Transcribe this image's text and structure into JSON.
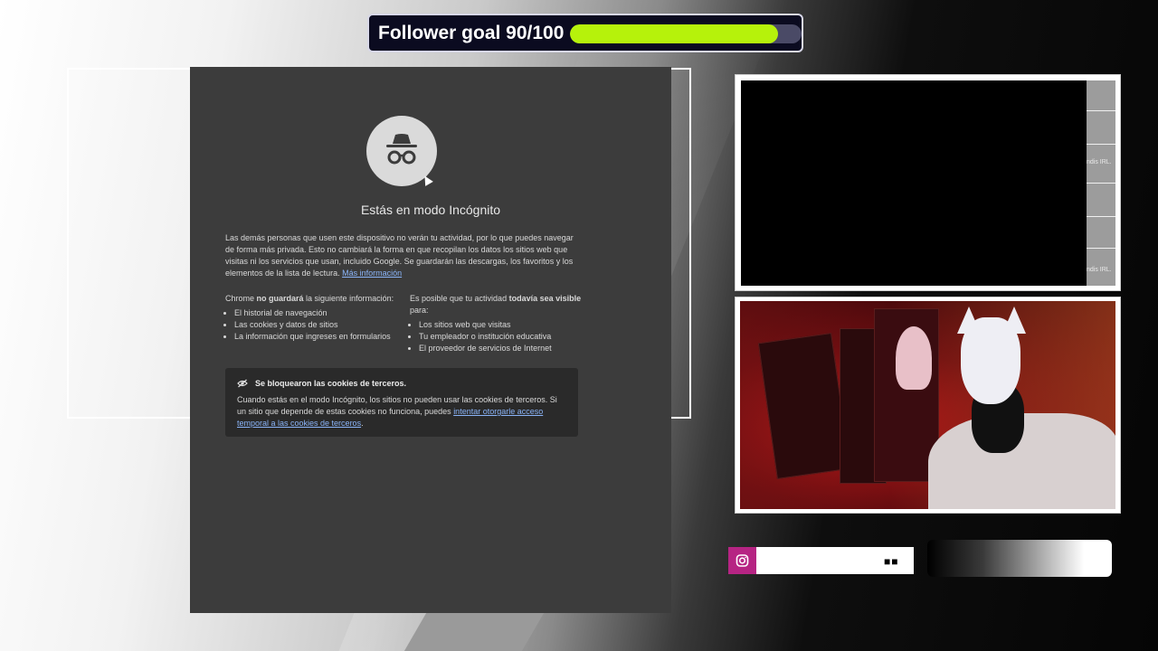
{
  "follower_goal": {
    "label": "Follower goal 90/100",
    "progress_fraction": 0.9,
    "bar_color": "#b6f20b"
  },
  "incognito": {
    "title": "Estás en modo Incógnito",
    "description": "Las demás personas que usen este dispositivo no verán tu actividad, por lo que puedes navegar de forma más privada. Esto no cambiará la forma en que recopilan los datos los sitios web que visitas ni los servicios que usan, incluido Google. Se guardarán las descargas, los favoritos y los elementos de la lista de lectura.",
    "more_info_link": "Más información",
    "not_saved": {
      "heading_pre": "Chrome ",
      "heading_bold": "no guardará",
      "heading_post": " la siguiente información:",
      "items": [
        "El historial de navegación",
        "Las cookies y datos de sitios",
        "La información que ingreses en formularios"
      ]
    },
    "visible": {
      "heading_pre": "Es posible que tu actividad ",
      "heading_bold": "todavía sea visible",
      "heading_post": " para:",
      "items": [
        "Los sitios web que visitas",
        "Tu empleador o institución educativa",
        "El proveedor de servicios de Internet"
      ]
    },
    "cookies": {
      "title": "Se bloquearon las cookies de terceros.",
      "text": "Cuando estás en el modo Incógnito, los sitios no pueden usar las cookies de terceros. Si un sitio que depende de estas cookies no funciona, puedes ",
      "link": "intentar otorgarle acceso temporal a las cookies de terceros",
      "text_end": "."
    }
  },
  "capture_side_labels": [
    "ndis IRL.",
    "ndis IRL."
  ],
  "instagram": {
    "icon": "instagram-icon",
    "handle": "■■",
    "accent": "#b62483"
  }
}
